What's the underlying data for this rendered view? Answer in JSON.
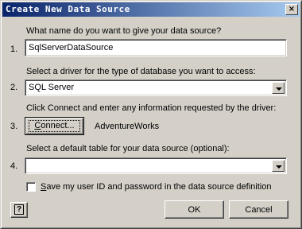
{
  "window": {
    "title": "Create New Data Source",
    "close_glyph": "×"
  },
  "steps": [
    {
      "number": "1.",
      "prompt": "What name do you want to give your data source?",
      "value": "SqlServerDataSource"
    },
    {
      "number": "2.",
      "prompt": "Select a driver for the type of database you want to access:",
      "value": "SQL Server"
    },
    {
      "number": "3.",
      "prompt": "Click Connect and enter any information requested by the driver:",
      "button_label_mnemonic": "C",
      "button_label_rest": "onnect...",
      "status": "AdventureWorks"
    },
    {
      "number": "4.",
      "prompt": "Select a default table for your data source (optional):",
      "value": ""
    }
  ],
  "save_checkbox": {
    "label_mnemonic": "S",
    "label_rest": "ave my user ID and password in the data source definition",
    "checked": false
  },
  "buttons": {
    "help_glyph": "?",
    "ok": "OK",
    "cancel": "Cancel"
  }
}
